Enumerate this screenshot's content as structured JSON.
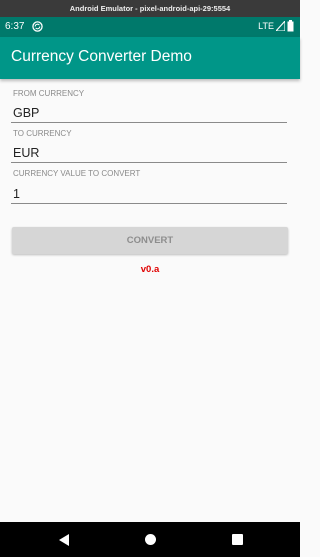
{
  "emulator": {
    "title": "Android Emulator - pixel-android-api-29:5554"
  },
  "status_bar": {
    "time": "6:37",
    "network": "LTE",
    "icons": [
      "sync-icon",
      "signal-icon",
      "battery-icon"
    ]
  },
  "app_bar": {
    "title": "Currency Converter Demo"
  },
  "form": {
    "from_label": "FROM CURRENCY",
    "from_value": "GBP",
    "to_label": "TO CURRENCY",
    "to_value": "EUR",
    "amount_label": "CURRENCY VALUE TO CONVERT",
    "amount_value": "1",
    "convert_label": "CONVERT"
  },
  "version": "v0.a",
  "colors": {
    "primary": "#009688",
    "primary_dark": "#00796b",
    "version_text": "#e00000"
  },
  "nav_bar": {
    "icons": [
      "back-icon",
      "home-icon",
      "recents-icon"
    ]
  }
}
